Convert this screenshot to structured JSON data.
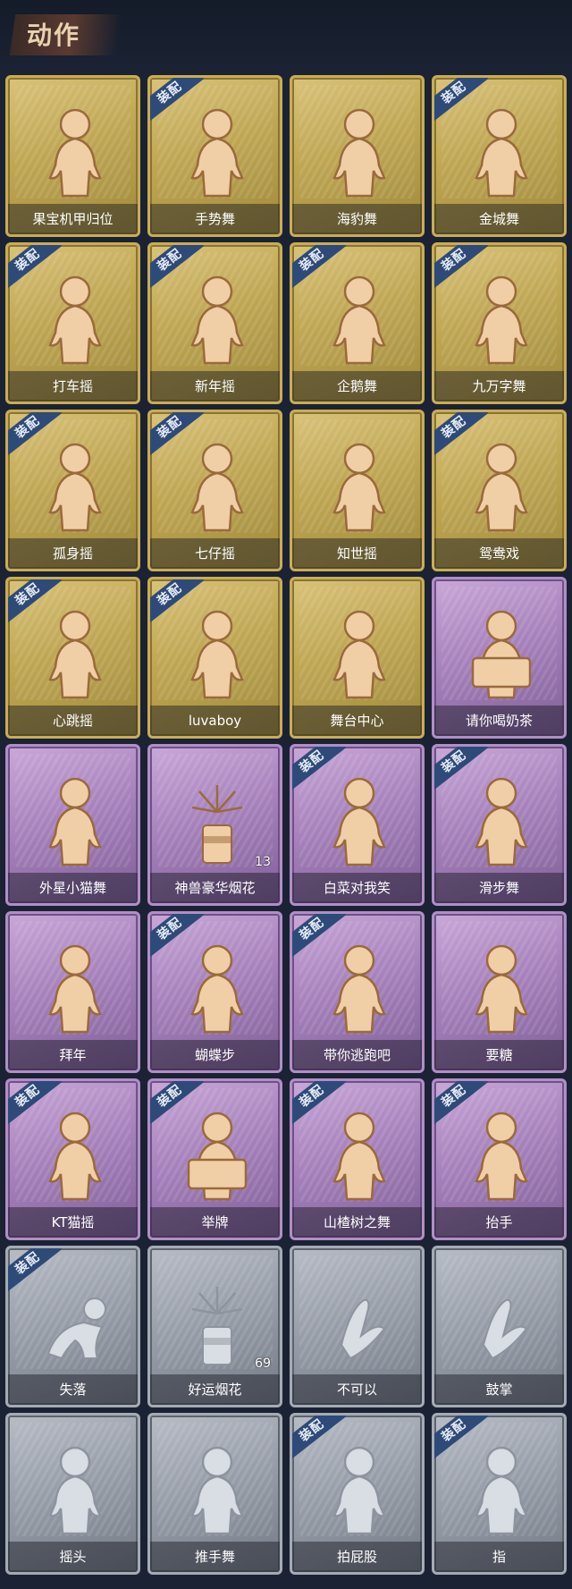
{
  "header": {
    "title": "动作"
  },
  "colors": {
    "gold": "#c8ad55",
    "purple": "#b08ec6",
    "gray": "#a5abb5",
    "equip_badge": "#2d4a78"
  },
  "equip_label": "装配",
  "cards": [
    {
      "name": "果宝机甲归位",
      "tier": "gold",
      "equipped": false,
      "icon": "dance-pose-icon"
    },
    {
      "name": "手势舞",
      "tier": "gold",
      "equipped": true,
      "icon": "dance-pose-icon"
    },
    {
      "name": "海豹舞",
      "tier": "gold",
      "equipped": false,
      "icon": "dance-pose-icon"
    },
    {
      "name": "金城舞",
      "tier": "gold",
      "equipped": true,
      "icon": "dance-pose-icon"
    },
    {
      "name": "打车摇",
      "tier": "gold",
      "equipped": true,
      "icon": "dance-pose-icon"
    },
    {
      "name": "新年摇",
      "tier": "gold",
      "equipped": true,
      "icon": "dance-pose-icon"
    },
    {
      "name": "企鹅舞",
      "tier": "gold",
      "equipped": true,
      "icon": "dance-pose-icon"
    },
    {
      "name": "九万字舞",
      "tier": "gold",
      "equipped": true,
      "icon": "dance-pose-icon"
    },
    {
      "name": "孤身摇",
      "tier": "gold",
      "equipped": true,
      "icon": "dance-pose-icon"
    },
    {
      "name": "七仔摇",
      "tier": "gold",
      "equipped": true,
      "icon": "dance-pose-icon"
    },
    {
      "name": "知世摇",
      "tier": "gold",
      "equipped": false,
      "icon": "dance-pose-icon"
    },
    {
      "name": "鸳鸯戏",
      "tier": "gold",
      "equipped": true,
      "icon": "dance-pose-icon"
    },
    {
      "name": "心跳摇",
      "tier": "gold",
      "equipped": true,
      "icon": "dance-pose-icon"
    },
    {
      "name": "luvaboy",
      "tier": "gold",
      "equipped": true,
      "icon": "dance-pose-icon"
    },
    {
      "name": "舞台中心",
      "tier": "gold",
      "equipped": false,
      "icon": "dance-pose-icon"
    },
    {
      "name": "请你喝奶茶",
      "tier": "purple",
      "equipped": false,
      "icon": "sign-holding-icon"
    },
    {
      "name": "外星小猫舞",
      "tier": "purple",
      "equipped": false,
      "icon": "dance-pose-icon"
    },
    {
      "name": "神兽豪华烟花",
      "tier": "purple",
      "equipped": false,
      "icon": "fireworks-icon",
      "count": "13"
    },
    {
      "name": "白菜对我笑",
      "tier": "purple",
      "equipped": true,
      "icon": "dance-pose-icon"
    },
    {
      "name": "滑步舞",
      "tier": "purple",
      "equipped": true,
      "icon": "dance-pose-icon"
    },
    {
      "name": "拜年",
      "tier": "purple",
      "equipped": false,
      "icon": "greeting-pose-icon"
    },
    {
      "name": "蝴蝶步",
      "tier": "purple",
      "equipped": true,
      "icon": "dance-pose-icon"
    },
    {
      "name": "带你逃跑吧",
      "tier": "purple",
      "equipped": true,
      "icon": "dance-pose-icon"
    },
    {
      "name": "要糖",
      "tier": "purple",
      "equipped": false,
      "icon": "dance-pose-icon"
    },
    {
      "name": "KT猫摇",
      "tier": "purple",
      "equipped": true,
      "icon": "dance-pose-icon"
    },
    {
      "name": "举牌",
      "tier": "purple",
      "equipped": true,
      "icon": "sign-holding-icon"
    },
    {
      "name": "山楂树之舞",
      "tier": "purple",
      "equipped": true,
      "icon": "dance-pose-icon"
    },
    {
      "name": "抬手",
      "tier": "purple",
      "equipped": true,
      "icon": "dance-pose-icon"
    },
    {
      "name": "失落",
      "tier": "gray",
      "equipped": true,
      "icon": "crawling-pose-icon"
    },
    {
      "name": "好运烟花",
      "tier": "gray",
      "equipped": false,
      "icon": "firework-can-icon",
      "count": "69"
    },
    {
      "name": "不可以",
      "tier": "gray",
      "equipped": false,
      "icon": "finger-wag-icon"
    },
    {
      "name": "鼓掌",
      "tier": "gray",
      "equipped": false,
      "icon": "clapping-hands-icon"
    },
    {
      "name": "摇头",
      "tier": "gray",
      "equipped": false,
      "icon": "dance-pose-icon"
    },
    {
      "name": "推手舞",
      "tier": "gray",
      "equipped": false,
      "icon": "dance-pose-icon"
    },
    {
      "name": "拍屁股",
      "tier": "gray",
      "equipped": true,
      "icon": "dance-pose-icon"
    },
    {
      "name": "指",
      "tier": "gray",
      "equipped": true,
      "icon": "pointing-pose-icon"
    }
  ]
}
